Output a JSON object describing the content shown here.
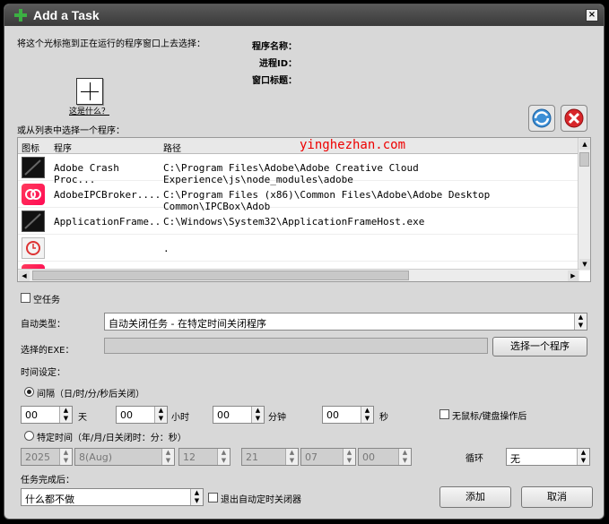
{
  "window": {
    "title": "Add a Task",
    "close_label": "×"
  },
  "drag": {
    "instruction": "将这个光标拖到正在运行的程序窗口上去选择：",
    "what_is_this": "这是什么？",
    "program_name_label": "程序名称：",
    "process_id_label": "进程ID：",
    "window_title_label": "窗口标题："
  },
  "list": {
    "caption": "或从列表中选择一个程序：",
    "columns": [
      "图标",
      "程序",
      "路径"
    ],
    "rows": [
      {
        "program": "Adobe Crash Proc...",
        "path": "C:\\Program Files\\Adobe\\Adobe Creative Cloud Experience\\js\\node_modules\\adobe",
        "icon": "dark-app-icon"
      },
      {
        "program": "AdobeIPCBroker....",
        "path": "C:\\Program Files (x86)\\Common Files\\Adobe\\Adobe Desktop Common\\IPCBox\\Adob",
        "icon": "creative-cloud-icon"
      },
      {
        "program": "ApplicationFrame...",
        "path": "C:\\Windows\\System32\\ApplicationFrameHost.exe",
        "icon": "dark-app-icon"
      },
      {
        "program": "",
        "path": ".",
        "icon": "clock-app-icon"
      },
      {
        "program": "",
        "path": "",
        "icon": "creative-cloud-icon"
      }
    ]
  },
  "watermark": "yinghezhan.com",
  "empty_task_label": "空任务",
  "auto_type": {
    "label": "自动类型：",
    "value": "自动关闭任务 - 在特定时间关闭程序"
  },
  "exe": {
    "label": "选择的EXE：",
    "value": "",
    "button": "选择一个程序"
  },
  "time": {
    "section_label": "时间设定：",
    "interval_label": "间隔（日/时/分/秒后关闭）",
    "days": {
      "value": "00",
      "unit": "天"
    },
    "hours": {
      "value": "00",
      "unit": "小时"
    },
    "minutes": {
      "value": "00",
      "unit": "分钟"
    },
    "seconds": {
      "value": "00",
      "unit": "秒"
    },
    "no_input_label": "无鼠标/键盘操作后",
    "specific_label": "特定时间（年/月/日关闭时：分：秒）",
    "year": "2025",
    "month": "8(Aug)",
    "day": "12",
    "hour": "21",
    "minute": "07",
    "second": "00",
    "loop_label": "循环",
    "loop_value": "无"
  },
  "after": {
    "label": "任务完成后：",
    "value": "什么都不做",
    "exit_label": "退出自动定时关闭器"
  },
  "buttons": {
    "add": "添加",
    "cancel": "取消"
  }
}
